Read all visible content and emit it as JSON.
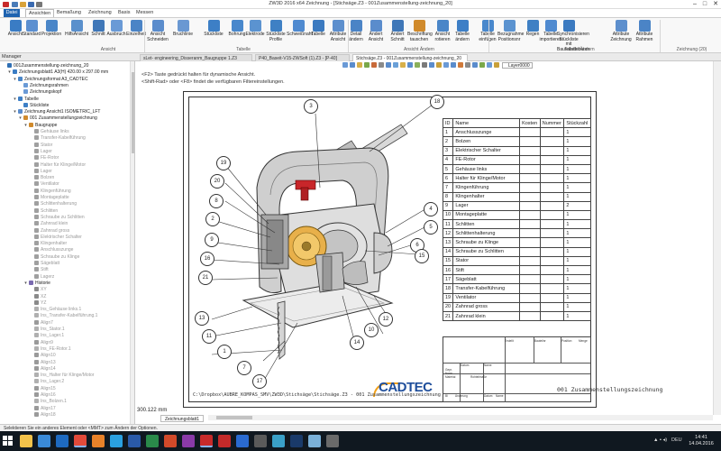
{
  "window": {
    "title": "ZW3D 2016  x64          Zeichnung - [Stichsäge.Z3 - 001Zusammenstellung-zeichnung_20]",
    "controls": {
      "minimize": "–",
      "maximize": "□",
      "close": "✕"
    }
  },
  "menu": {
    "file": "Datei",
    "tabs": [
      "Ansichten",
      "Bemaßung",
      "Zeichnung",
      "Basis",
      "Messen"
    ],
    "active_tab": "Ansichten"
  },
  "ribbon": {
    "buttons": [
      {
        "label": "Ansicht",
        "icon": "view-icon",
        "color": "#3a7cc4"
      },
      {
        "label": "Standard",
        "icon": "standard-view-icon",
        "color": "#5b8fd0"
      },
      {
        "label": "Projektion",
        "icon": "projection-icon",
        "color": "#4a86c8"
      },
      {
        "label": "HilfsAnsicht",
        "icon": "auxiliary-view-icon",
        "color": "#5a90cc"
      },
      {
        "label": "Schnitt",
        "icon": "section-icon",
        "color": "#3f77b8"
      },
      {
        "label": "Ausbruch",
        "icon": "breakout-icon",
        "color": "#6a9ad6"
      },
      {
        "label": "Einzelheit",
        "icon": "detail-icon",
        "color": "#4b84c6"
      },
      {
        "label": "Ansicht Schneiden",
        "icon": "cut-view-icon",
        "color": "#5a8ccc"
      },
      {
        "label": "Bruchlinie",
        "icon": "break-line-icon",
        "color": "#6a98d2"
      },
      {
        "label": "Stückliste",
        "icon": "bom-icon",
        "color": "#3d7fc6"
      },
      {
        "label": "Bohrung",
        "icon": "hole-table-icon",
        "color": "#4988cc"
      },
      {
        "label": "Elektrode",
        "icon": "electrode-icon",
        "color": "#5b93d0"
      },
      {
        "label": "Stückliste Profile",
        "icon": "profile-bom-icon",
        "color": "#3f80c4"
      },
      {
        "label": "Schweißnaht",
        "icon": "weld-icon",
        "color": "#4f8ad0"
      },
      {
        "label": "Tabelle",
        "icon": "table-icon",
        "color": "#3b7ac0"
      },
      {
        "label": "Attribute Ansicht",
        "icon": "view-attributes-icon",
        "color": "#5d8fcd"
      },
      {
        "label": "Detail ändern",
        "icon": "edit-detail-icon",
        "color": "#4b84c6"
      },
      {
        "label": "Ändert Ansicht",
        "icon": "change-view-icon",
        "color": "#5a8ccc"
      },
      {
        "label": "Ändert Schnitt",
        "icon": "change-section-icon",
        "color": "#3f77b8"
      },
      {
        "label": "Beschriftung tauschen",
        "icon": "swap-label-icon",
        "color": "#d08a2c"
      },
      {
        "label": "Ansicht rotieren",
        "icon": "rotate-view-icon",
        "color": "#4a86c8"
      },
      {
        "label": "Tabelle ändern",
        "icon": "edit-table-icon",
        "color": "#3d7fc6"
      },
      {
        "label": "Tabelle einfügen",
        "icon": "insert-table-icon",
        "color": "#4988cc"
      },
      {
        "label": "Bezugnahme Positionsnr",
        "icon": "position-number-icon",
        "color": "#5b93d0"
      },
      {
        "label": "Regen",
        "icon": "regenerate-icon",
        "color": "#3f80c4"
      },
      {
        "label": "Tabelle importieren",
        "icon": "import-table-icon",
        "color": "#4f8ad0"
      },
      {
        "label": "Synchronisieren Stückliste mit Bauteilattributen",
        "icon": "sync-bom-icon",
        "color": "#3b7ac0"
      },
      {
        "label": "Attribute Zeichnung",
        "icon": "drawing-attributes-icon",
        "color": "#5d8fcd"
      },
      {
        "label": "Attribute Rahmen",
        "icon": "frame-attributes-icon",
        "color": "#4b84c6"
      }
    ],
    "groups": [
      "Ansicht",
      "Tabelle",
      "Ansicht Ändern",
      "Tabelle Ändern",
      "Zeichnung (20)"
    ]
  },
  "tabs_bar": {
    "manager_label": "Manager",
    "documents": [
      {
        "label": "sLet- engineering_Disseranm_Baugruppe 1.Z3",
        "active": false
      },
      {
        "label": "P40_Baseit-V15-ZWSoft (1).Z3 - [P-40]",
        "active": false
      },
      {
        "label": "Stichsäge.Z3 - 001Zusammenstellung-zeichnung_20",
        "active": true
      }
    ]
  },
  "view_toolbar": {
    "layer": "Layer0000"
  },
  "hints": [
    "<F2> Taste gedrückt halten für dynamische Ansicht.",
    "<Shift-Rad> oder <F8> findet die verfügbaren Filtereinstellungen."
  ],
  "tree": [
    {
      "label": "001Zusammenstellung-zeichnung_20",
      "indent": 0,
      "icon": "drawing",
      "arrow": "",
      "muted": false
    },
    {
      "label": "Zeichnungsblatt1 A3(H) 420.00 x 297.00 mm",
      "indent": 1,
      "icon": "sheet",
      "arrow": "▾",
      "muted": false
    },
    {
      "label": "Zeichnungsformat A3_CADTEC",
      "indent": 2,
      "icon": "format",
      "arrow": "▾",
      "muted": false
    },
    {
      "label": "Zeichnungsrahmen",
      "indent": 3,
      "icon": "frame",
      "arrow": "",
      "muted": false
    },
    {
      "label": "Zeichnungskopf",
      "indent": 3,
      "icon": "frame",
      "arrow": "",
      "muted": false
    },
    {
      "label": "Tabelle",
      "indent": 2,
      "icon": "table",
      "arrow": "▾",
      "muted": false
    },
    {
      "label": "Stückliste",
      "indent": 3,
      "icon": "table",
      "arrow": "",
      "muted": false
    },
    {
      "label": "Zeichnung Ansicht1 ISOMETRIC_LFT",
      "indent": 2,
      "icon": "view",
      "arrow": "▾",
      "muted": false
    },
    {
      "label": "001 Zusammenstellungzeichnung",
      "indent": 3,
      "icon": "assembly",
      "arrow": "▾",
      "muted": false
    },
    {
      "label": "Baugruppe",
      "indent": 4,
      "icon": "assembly",
      "arrow": "▾",
      "muted": false
    },
    {
      "label": "Gehäuse links",
      "indent": 5,
      "icon": "part",
      "arrow": "",
      "muted": true
    },
    {
      "label": "Transfer-Kabelführung",
      "indent": 5,
      "icon": "part",
      "arrow": "",
      "muted": true
    },
    {
      "label": "Stator",
      "indent": 5,
      "icon": "part",
      "arrow": "",
      "muted": true
    },
    {
      "label": "Lager",
      "indent": 5,
      "icon": "part",
      "arrow": "",
      "muted": true
    },
    {
      "label": "FE-Rotor",
      "indent": 5,
      "icon": "part",
      "arrow": "",
      "muted": true
    },
    {
      "label": "Halter für Klinge/Motor",
      "indent": 5,
      "icon": "part",
      "arrow": "",
      "muted": true
    },
    {
      "label": "Lager",
      "indent": 5,
      "icon": "part",
      "arrow": "",
      "muted": true
    },
    {
      "label": "Bolzen",
      "indent": 5,
      "icon": "part",
      "arrow": "",
      "muted": true
    },
    {
      "label": "Ventilator",
      "indent": 5,
      "icon": "part",
      "arrow": "",
      "muted": true
    },
    {
      "label": "Klingenführung",
      "indent": 5,
      "icon": "part",
      "arrow": "",
      "muted": true
    },
    {
      "label": "Montageplatte",
      "indent": 5,
      "icon": "part",
      "arrow": "",
      "muted": true
    },
    {
      "label": "Schlittenhalterung",
      "indent": 5,
      "icon": "part",
      "arrow": "",
      "muted": true
    },
    {
      "label": "Schlitten",
      "indent": 5,
      "icon": "part",
      "arrow": "",
      "muted": true
    },
    {
      "label": "Schraube zu Schlitten",
      "indent": 5,
      "icon": "part",
      "arrow": "",
      "muted": true
    },
    {
      "label": "Zahnrad klein",
      "indent": 5,
      "icon": "part",
      "arrow": "",
      "muted": true
    },
    {
      "label": "Zahnrad gross",
      "indent": 5,
      "icon": "part",
      "arrow": "",
      "muted": true
    },
    {
      "label": "Elektrischer Schalter",
      "indent": 5,
      "icon": "part",
      "arrow": "",
      "muted": true
    },
    {
      "label": "Klingenhalter",
      "indent": 5,
      "icon": "part",
      "arrow": "",
      "muted": true
    },
    {
      "label": "Anschlusszunge",
      "indent": 5,
      "icon": "part",
      "arrow": "",
      "muted": true
    },
    {
      "label": "Schraube zu Klinge",
      "indent": 5,
      "icon": "part",
      "arrow": "",
      "muted": true
    },
    {
      "label": "Sägeblatt",
      "indent": 5,
      "icon": "part",
      "arrow": "",
      "muted": true
    },
    {
      "label": "Stift",
      "indent": 5,
      "icon": "part",
      "arrow": "",
      "muted": true
    },
    {
      "label": "Lagerz",
      "indent": 5,
      "icon": "part",
      "arrow": "",
      "muted": true
    },
    {
      "label": "Historie",
      "indent": 4,
      "icon": "history",
      "arrow": "▾",
      "muted": false
    },
    {
      "label": "XY",
      "indent": 5,
      "icon": "plane",
      "arrow": "",
      "muted": true
    },
    {
      "label": "XZ",
      "indent": 5,
      "icon": "plane",
      "arrow": "",
      "muted": true
    },
    {
      "label": "YZ",
      "indent": 5,
      "icon": "plane",
      "arrow": "",
      "muted": true
    },
    {
      "label": "Ins_Gehäuse links.1",
      "indent": 5,
      "icon": "insert",
      "arrow": "",
      "muted": true
    },
    {
      "label": "Ins_Transfer-Kabelführung.1",
      "indent": 5,
      "icon": "insert",
      "arrow": "",
      "muted": true
    },
    {
      "label": "Align7",
      "indent": 5,
      "icon": "align",
      "arrow": "",
      "muted": true
    },
    {
      "label": "Ins_Stator.1",
      "indent": 5,
      "icon": "insert",
      "arrow": "",
      "muted": true
    },
    {
      "label": "Ins_Lager.1",
      "indent": 5,
      "icon": "insert",
      "arrow": "",
      "muted": true
    },
    {
      "label": "Align9",
      "indent": 5,
      "icon": "align",
      "arrow": "",
      "muted": true
    },
    {
      "label": "Ins_FE-Rotor.1",
      "indent": 5,
      "icon": "insert",
      "arrow": "",
      "muted": true
    },
    {
      "label": "Align10",
      "indent": 5,
      "icon": "align",
      "arrow": "",
      "muted": true
    },
    {
      "label": "Align13",
      "indent": 5,
      "icon": "align",
      "arrow": "",
      "muted": true
    },
    {
      "label": "Align14",
      "indent": 5,
      "icon": "align",
      "arrow": "",
      "muted": true
    },
    {
      "label": "Ins_Halter für Klinge/Motor",
      "indent": 5,
      "icon": "insert",
      "arrow": "",
      "muted": true
    },
    {
      "label": "Ins_Lager.2",
      "indent": 5,
      "icon": "insert",
      "arrow": "",
      "muted": true
    },
    {
      "label": "Align15",
      "indent": 5,
      "icon": "align",
      "arrow": "",
      "muted": true
    },
    {
      "label": "Align16",
      "indent": 5,
      "icon": "align",
      "arrow": "",
      "muted": true
    },
    {
      "label": "Ins_Bolzen.1",
      "indent": 5,
      "icon": "insert",
      "arrow": "",
      "muted": true
    },
    {
      "label": "Align17",
      "indent": 5,
      "icon": "align",
      "arrow": "",
      "muted": true
    },
    {
      "label": "Align18",
      "indent": 5,
      "icon": "align",
      "arrow": "",
      "muted": true
    }
  ],
  "tree_icon_colors": {
    "drawing": "#2f6fb4",
    "sheet": "#3a7cc4",
    "format": "#4a86c8",
    "frame": "#6a9ad6",
    "table": "#3d7fc6",
    "view": "#5a8ccc",
    "assembly": "#d08a2c",
    "part": "#a0a0a0",
    "history": "#7a6ab0",
    "plane": "#8a8a8a",
    "insert": "#b0b0b0",
    "align": "#9a9a9a"
  },
  "bom": {
    "headers": [
      "ID",
      "Name",
      "Kosten",
      "Nummer",
      "Stückzahl"
    ],
    "rows": [
      [
        "1",
        "Anschlusszunge",
        "",
        "",
        "1"
      ],
      [
        "2",
        "Bolzen",
        "",
        "",
        "1"
      ],
      [
        "3",
        "Elektrischer Schalter",
        "",
        "",
        "1"
      ],
      [
        "4",
        "FE-Rotor",
        "",
        "",
        "1"
      ],
      [
        "5",
        "Gehäuse links",
        "",
        "",
        "1"
      ],
      [
        "6",
        "Halter für Klinge/Motor",
        "",
        "",
        "1"
      ],
      [
        "7",
        "Klingenführung",
        "",
        "",
        "1"
      ],
      [
        "8",
        "Klingenhalter",
        "",
        "",
        "1"
      ],
      [
        "9",
        "Lager",
        "",
        "",
        "2"
      ],
      [
        "10",
        "Montageplatte",
        "",
        "",
        "1"
      ],
      [
        "11",
        "Schlitten",
        "",
        "",
        "1"
      ],
      [
        "12",
        "Schlittenhalterung",
        "",
        "",
        "1"
      ],
      [
        "13",
        "Schraube zu Klinge",
        "",
        "",
        "1"
      ],
      [
        "14",
        "Schraube zu Schlitten",
        "",
        "",
        "1"
      ],
      [
        "15",
        "Stator",
        "",
        "",
        "1"
      ],
      [
        "16",
        "Stift",
        "",
        "",
        "1"
      ],
      [
        "17",
        "Sägeblatt",
        "",
        "",
        "1"
      ],
      [
        "18",
        "Transfer-Kabelführung",
        "",
        "",
        "1"
      ],
      [
        "19",
        "Ventilator",
        "",
        "",
        "1"
      ],
      [
        "20",
        "Zahnrad gross",
        "",
        "",
        "1"
      ],
      [
        "21",
        "Zahnrad klein",
        "",
        "",
        "1"
      ]
    ]
  },
  "title_block": {
    "drawing_title": "001 Zusammenstellungszeichnung",
    "logo": "CADTEC",
    "file_path": "C:\\Dropbox\\AUBRE_KOMPAS_SMV\\ZW3D\\Stichsäge\\Stichsäge.Z3 - 001 Zusammenstellungszeichnung",
    "labels": [
      "Erstellt",
      "Bauteilnr",
      "Position",
      "Menge",
      "Datum",
      "Name",
      "Gepr.",
      "Norm",
      "Material",
      "Rohteilmaße",
      "Bl",
      "Änderung",
      "Datum",
      "Name"
    ]
  },
  "balloons": [
    "3",
    "18",
    "19",
    "20",
    "8",
    "2",
    "9",
    "16",
    "21",
    "1",
    "13",
    "11",
    "7",
    "17",
    "14",
    "10",
    "12",
    "4",
    "5",
    "6",
    "15"
  ],
  "canvas_footer": {
    "scale": "300.122 mm",
    "sheet_tab": "Zeichnungsblatt1"
  },
  "status": {
    "text": "Selektieren Sie ein anderes Element oder <MMT> zum Ändern der Optionen."
  },
  "taskbar": {
    "apps": [
      {
        "name": "file-explorer",
        "color": "#f2c24a",
        "open": false
      },
      {
        "name": "browser-edge",
        "color": "#3a8ad8",
        "open": false
      },
      {
        "name": "outlook",
        "color": "#1e6ac0",
        "open": false
      },
      {
        "name": "chrome",
        "color": "#e24a3a",
        "open": true
      },
      {
        "name": "firefox",
        "color": "#e8822a",
        "open": false
      },
      {
        "name": "skype",
        "color": "#2aa0e0",
        "open": false
      },
      {
        "name": "word",
        "color": "#2a5aa8",
        "open": false
      },
      {
        "name": "excel",
        "color": "#2a8a4a",
        "open": false
      },
      {
        "name": "powerpoint",
        "color": "#d24a2a",
        "open": false
      },
      {
        "name": "onenote",
        "color": "#8a3aa8",
        "open": false
      },
      {
        "name": "zw3d",
        "color": "#c82a2a",
        "open": true
      },
      {
        "name": "acrobat",
        "color": "#c42a2a",
        "open": false
      },
      {
        "name": "teamviewer",
        "color": "#2a6ad0",
        "open": false
      },
      {
        "name": "calculator",
        "color": "#5a5a5a",
        "open": false
      },
      {
        "name": "paint",
        "color": "#3aa0c8",
        "open": false
      },
      {
        "name": "photoshop",
        "color": "#1a3a6a",
        "open": false
      },
      {
        "name": "notepad",
        "color": "#7ab0d8",
        "open": false
      },
      {
        "name": "settings",
        "color": "#6a6a6a",
        "open": false
      }
    ],
    "language": "DEU",
    "time": "14:41",
    "date": "14.04.2016"
  }
}
